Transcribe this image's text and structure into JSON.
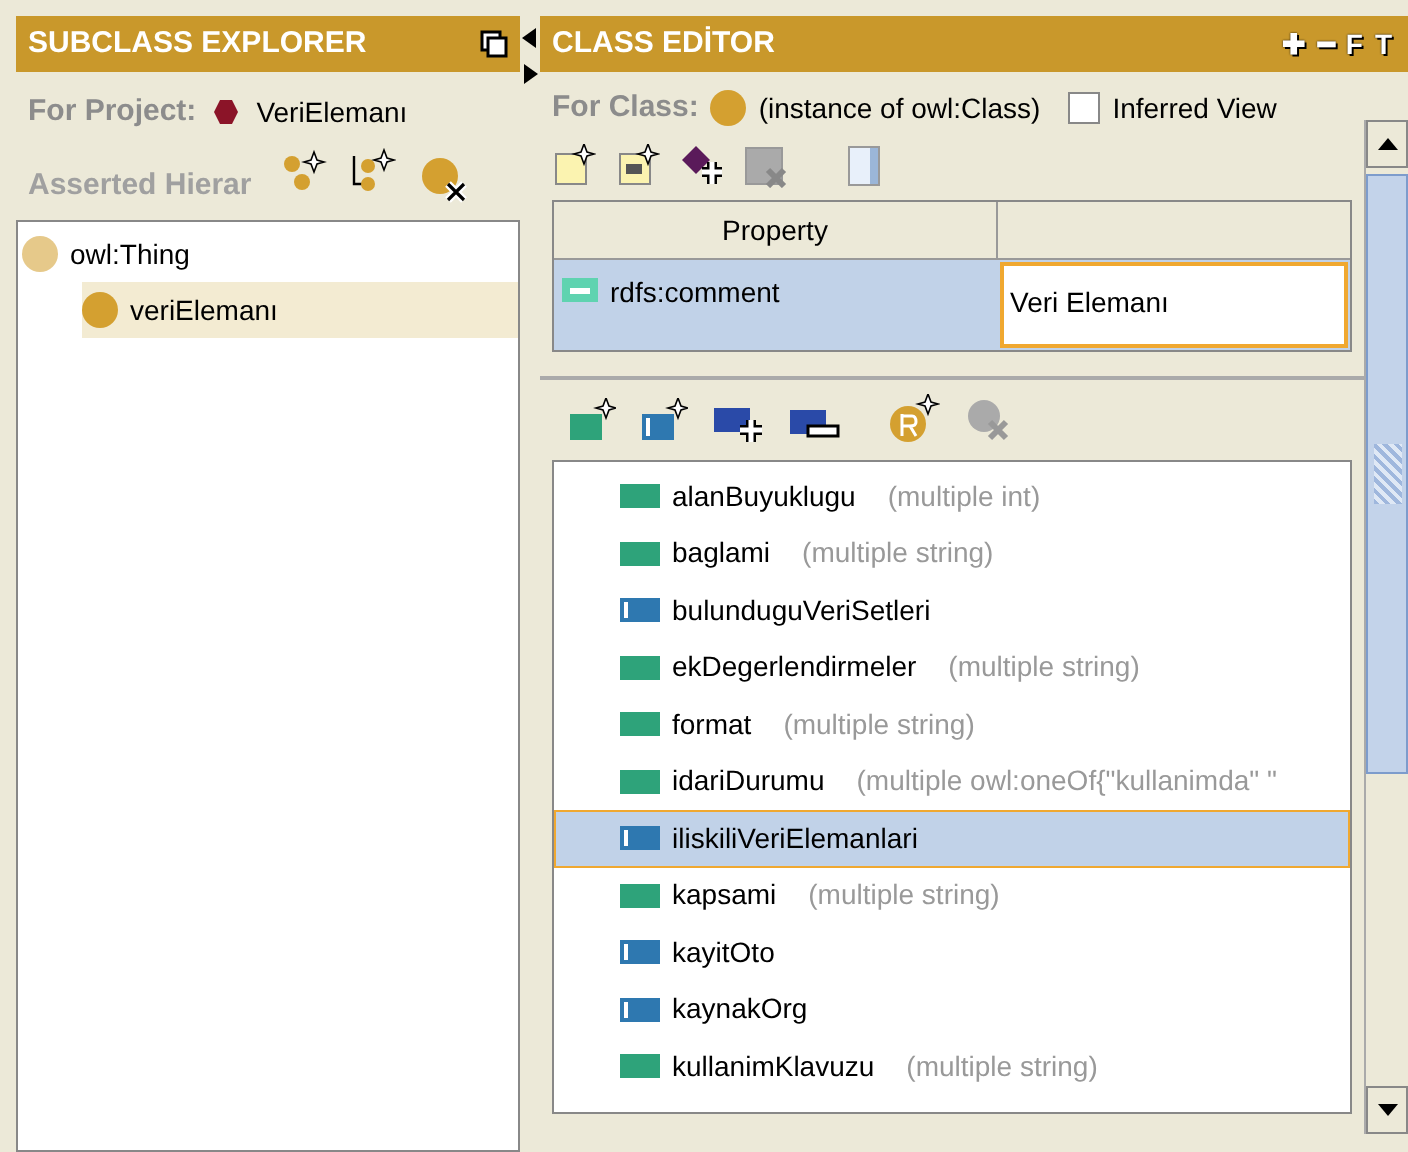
{
  "subclass_explorer": {
    "title": "SUBCLASS EXPLORER",
    "project_label": "For Project:",
    "project_name": "VeriElemanı",
    "hierarchy_label": "Asserted Hierar",
    "tree": [
      {
        "label": "owl:Thing",
        "selected": false,
        "children": [
          {
            "label": "veriElemanı",
            "selected": true
          }
        ]
      }
    ]
  },
  "class_editor": {
    "title": "CLASS EDİTOR",
    "header_buttons": [
      "✚",
      "━",
      "F",
      "T"
    ],
    "class_label": "For Class:",
    "class_type": "(instance of owl:Class)",
    "inferred_view": {
      "label": "Inferred View",
      "checked": false
    },
    "table": {
      "columns": [
        "Property",
        ""
      ],
      "rows": [
        {
          "property": "rdfs:comment",
          "value": "Veri Elemanı",
          "selected": true
        }
      ]
    },
    "properties": [
      {
        "name": "alanBuyuklugu",
        "kind": "datatype",
        "detail": "(multiple int)",
        "selected": false
      },
      {
        "name": "baglami",
        "kind": "datatype",
        "detail": "(multiple string)",
        "selected": false
      },
      {
        "name": "bulunduguVeriSetleri",
        "kind": "object",
        "selected": false
      },
      {
        "name": "ekDegerlendirmeler",
        "kind": "datatype",
        "detail": "(multiple string)",
        "selected": false
      },
      {
        "name": "format",
        "kind": "datatype",
        "detail": "(multiple string)",
        "selected": false
      },
      {
        "name": "idariDurumu",
        "kind": "datatype",
        "detail": "(multiple owl:oneOf{\"kullanimda\" \"",
        "selected": false
      },
      {
        "name": "iliskiliVeriElemanlari",
        "kind": "object",
        "selected": true
      },
      {
        "name": "kapsami",
        "kind": "datatype",
        "detail": "(multiple string)",
        "selected": false
      },
      {
        "name": "kayitOto",
        "kind": "object",
        "selected": false
      },
      {
        "name": "kaynakOrg",
        "kind": "object",
        "selected": false
      },
      {
        "name": "kullanimKlavuzu",
        "kind": "datatype",
        "detail": "(multiple string)",
        "selected": false
      }
    ]
  }
}
